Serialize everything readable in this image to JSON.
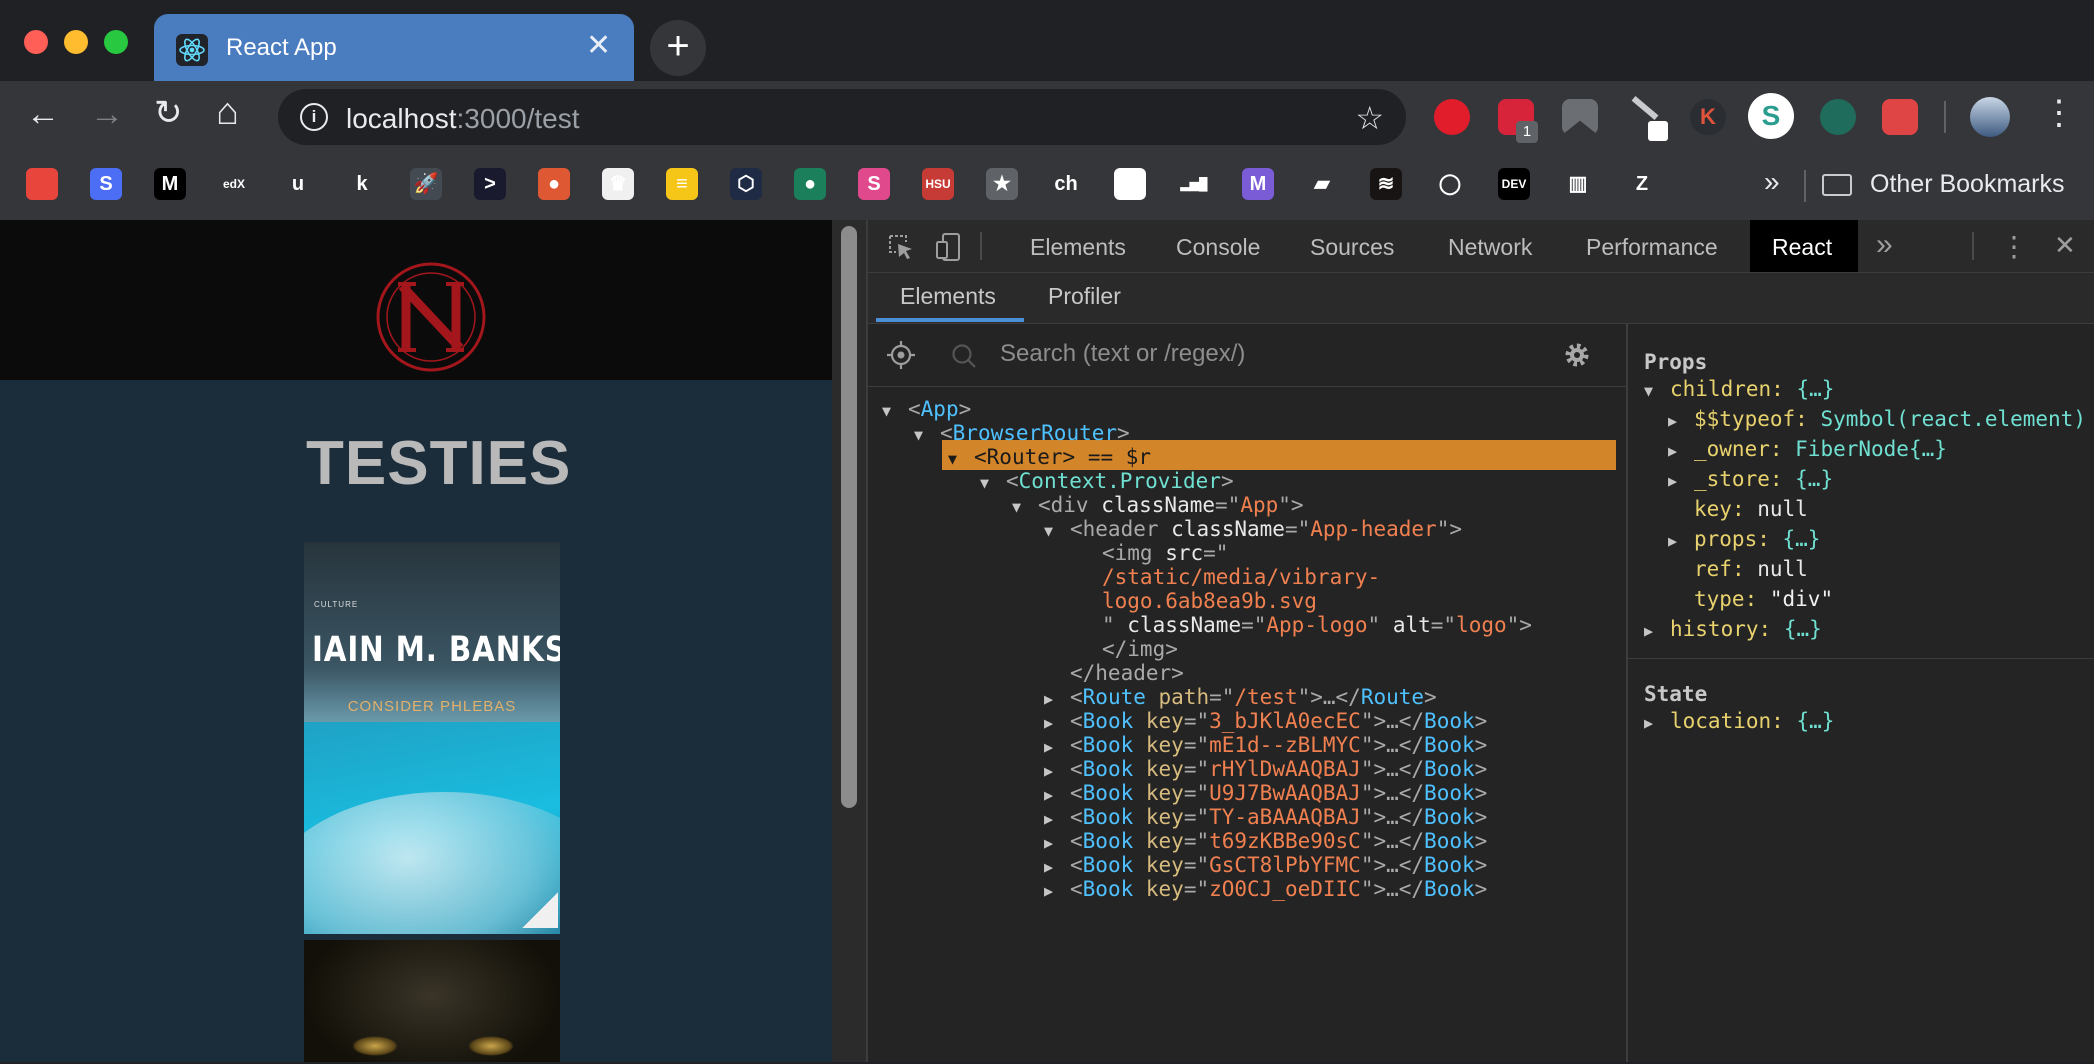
{
  "window": {
    "tab_title": "React App",
    "tab_close": "✕",
    "new_tab": "+"
  },
  "toolbar": {
    "back": "←",
    "forward": "→",
    "reload": "↻",
    "home": "⌂",
    "url_host": "localhost",
    "url_rest": ":3000/test",
    "bookmark_star": "☆",
    "menu": "⋮",
    "ext_badge": "1"
  },
  "bookmarks": {
    "items": [
      {
        "icon": "airtable-icon",
        "text": "",
        "color": "#e8453c"
      },
      {
        "icon": "s-icon",
        "text": "S",
        "color": "#4c6ef5"
      },
      {
        "icon": "medium-icon",
        "text": "M",
        "color": "#000000"
      },
      {
        "icon": "edx-icon",
        "text": "edX",
        "color": "#35363a"
      },
      {
        "icon": "udemy-icon",
        "text": "u",
        "color": "#35363a"
      },
      {
        "icon": "k-icon",
        "text": "k",
        "color": "#35363a"
      },
      {
        "icon": "rocket-icon",
        "text": "🚀",
        "color": "#444a52"
      },
      {
        "icon": "terminal-icon",
        "text": ">",
        "color": "#1a1a2e"
      },
      {
        "icon": "duckduckgo-icon",
        "text": "●",
        "color": "#de5833"
      },
      {
        "icon": "crown-icon",
        "text": "♛",
        "color": "#f0f0f0"
      },
      {
        "icon": "striped-icon",
        "text": "≡",
        "color": "#f5c518"
      },
      {
        "icon": "hex-icon",
        "text": "⬡",
        "color": "#1f2a44"
      },
      {
        "icon": "frog-icon",
        "text": "●",
        "color": "#1a7f5a"
      },
      {
        "icon": "s-pink-icon",
        "text": "S",
        "color": "#e04a8c"
      },
      {
        "icon": "hsu-icon",
        "text": "HSU",
        "color": "#c63b35"
      },
      {
        "icon": "star-icon",
        "text": "★",
        "color": "#5f6368"
      },
      {
        "icon": "ch-icon",
        "text": "ch",
        "color": "#35363a"
      },
      {
        "icon": "google-icon",
        "text": "◯",
        "color": "#ffffff"
      },
      {
        "icon": "bars-icon",
        "text": "▂▅█",
        "color": "#35363a"
      },
      {
        "icon": "mastodon-icon",
        "text": "M",
        "color": "#7a5cd6"
      },
      {
        "icon": "parallelogram-icon",
        "text": "▰",
        "color": "#35363a"
      },
      {
        "icon": "spotify-icon",
        "text": "≋",
        "color": "#191414"
      },
      {
        "icon": "ring-icon",
        "text": "◯",
        "color": "#35363a"
      },
      {
        "icon": "dev-icon",
        "text": "DEV",
        "color": "#000000"
      },
      {
        "icon": "book-icon",
        "text": "▥",
        "color": "#35363a"
      },
      {
        "icon": "z-icon",
        "text": "Z",
        "color": "#35363a"
      }
    ],
    "overflow": "»",
    "other_label": "Other Bookmarks"
  },
  "page": {
    "title": "TESTIES",
    "book1_author": "IAIN M. BANKS",
    "book1_title": "CONSIDER PHLEBAS",
    "book1_series": "CULTURE"
  },
  "devtools": {
    "tabs": [
      "Elements",
      "Console",
      "Sources",
      "Network",
      "Performance",
      "React"
    ],
    "more": "»",
    "kebab": "⋮",
    "close": "✕",
    "react_tabs": [
      "Elements",
      "Profiler"
    ],
    "search_placeholder": "Search (text or /regex/)",
    "tree": {
      "app": "App",
      "browser_router": "BrowserRouter",
      "router": "Router",
      "router_suffix": " == $r",
      "context_provider": "Context.Provider",
      "div_class": "App",
      "header_class": "App-header",
      "img_src_1": "/static/media/vibrary-",
      "img_src_2": "logo.6ab8ea9b.svg",
      "img_class": "App-logo",
      "img_alt": "logo",
      "route_path": "/test",
      "book_keys": [
        "3_bJKlA0ecEC",
        "mE1d--zBLMYC",
        "rHYlDwAAQBAJ",
        "U9J7BwAAQBAJ",
        "TY-aBAAAQBAJ",
        "t69zKBBe90sC",
        "GsCT8lPbYFMC",
        "zO0CJ_oeDIIC"
      ]
    },
    "props": {
      "props_label": "Props",
      "state_label": "State",
      "children": "children",
      "children_val": "{…}",
      "typeof_key": "$$typeof",
      "typeof_val": "Symbol(react.element)",
      "owner_key": "_owner",
      "owner_val": "FiberNode{…}",
      "store_key": "_store",
      "store_val": "{…}",
      "key_key": "key",
      "key_val": "null",
      "props_key": "props",
      "props_val": "{…}",
      "ref_key": "ref",
      "ref_val": "null",
      "type_key": "type",
      "type_val": "\"div\"",
      "history_key": "history",
      "history_val": "{…}",
      "location_key": "location",
      "location_val": "{…}"
    }
  },
  "colors": {
    "tab_active": "#4a7dc0",
    "selection": "#d3852a",
    "page_bg": "#1b2c3b"
  }
}
